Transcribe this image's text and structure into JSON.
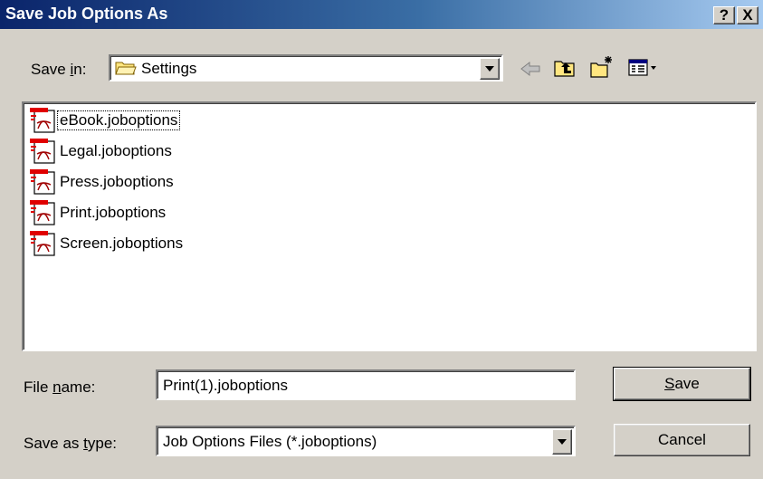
{
  "window": {
    "title": "Save Job Options As",
    "help_label": "?",
    "close_label": "X"
  },
  "save_in": {
    "label_pre": "Save ",
    "label_accel": "i",
    "label_post": "n:",
    "folder": "Settings"
  },
  "toolbar": {
    "icons": [
      "back-icon",
      "up-folder-icon",
      "new-folder-icon",
      "view-menu-icon"
    ]
  },
  "files": [
    {
      "name": "eBook.joboptions",
      "icon": "pdf-settings-file-icon"
    },
    {
      "name": "Legal.joboptions",
      "icon": "pdf-settings-file-icon"
    },
    {
      "name": "Press.joboptions",
      "icon": "pdf-settings-file-icon"
    },
    {
      "name": "Print.joboptions",
      "icon": "pdf-settings-file-icon"
    },
    {
      "name": "Screen.joboptions",
      "icon": "pdf-settings-file-icon"
    }
  ],
  "file_name": {
    "label_pre": "File ",
    "label_accel": "n",
    "label_post": "ame:",
    "value": "Print(1).joboptions"
  },
  "save_type": {
    "label_pre": "Save as ",
    "label_accel": "t",
    "label_post": "ype:",
    "value": "Job Options Files (*.joboptions)"
  },
  "buttons": {
    "save_accel": "S",
    "save_rest": "ave",
    "cancel": "Cancel"
  }
}
